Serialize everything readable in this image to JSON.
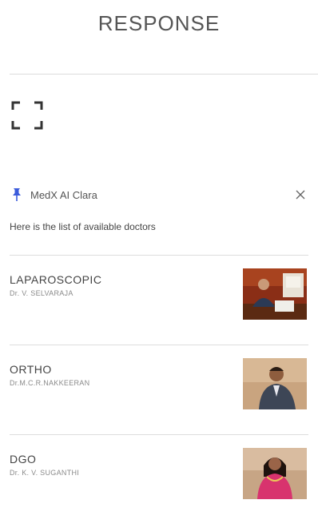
{
  "page": {
    "title": "RESPONSE"
  },
  "toolbar": {
    "expand_icon": "fullscreen-icon"
  },
  "chat": {
    "bot_icon": "pin-icon",
    "bot_name": "MedX AI Clara",
    "close_icon": "close-icon",
    "intro": "Here is the list of available doctors"
  },
  "doctors": [
    {
      "specialty": "LAPAROSCOPIC",
      "name": "Dr. V. SELVARAJA",
      "photo": "doctor-photo"
    },
    {
      "specialty": "ORTHO",
      "name": "Dr.M.C.R.NAKKEERAN",
      "photo": "doctor-photo"
    },
    {
      "specialty": "DGO",
      "name": "Dr. K. V. SUGANTHI",
      "photo": "doctor-photo"
    }
  ],
  "colors": {
    "accent": "#3b5bdb",
    "divider": "#dddddd",
    "text": "#444444",
    "muted": "#8a8a8a"
  }
}
